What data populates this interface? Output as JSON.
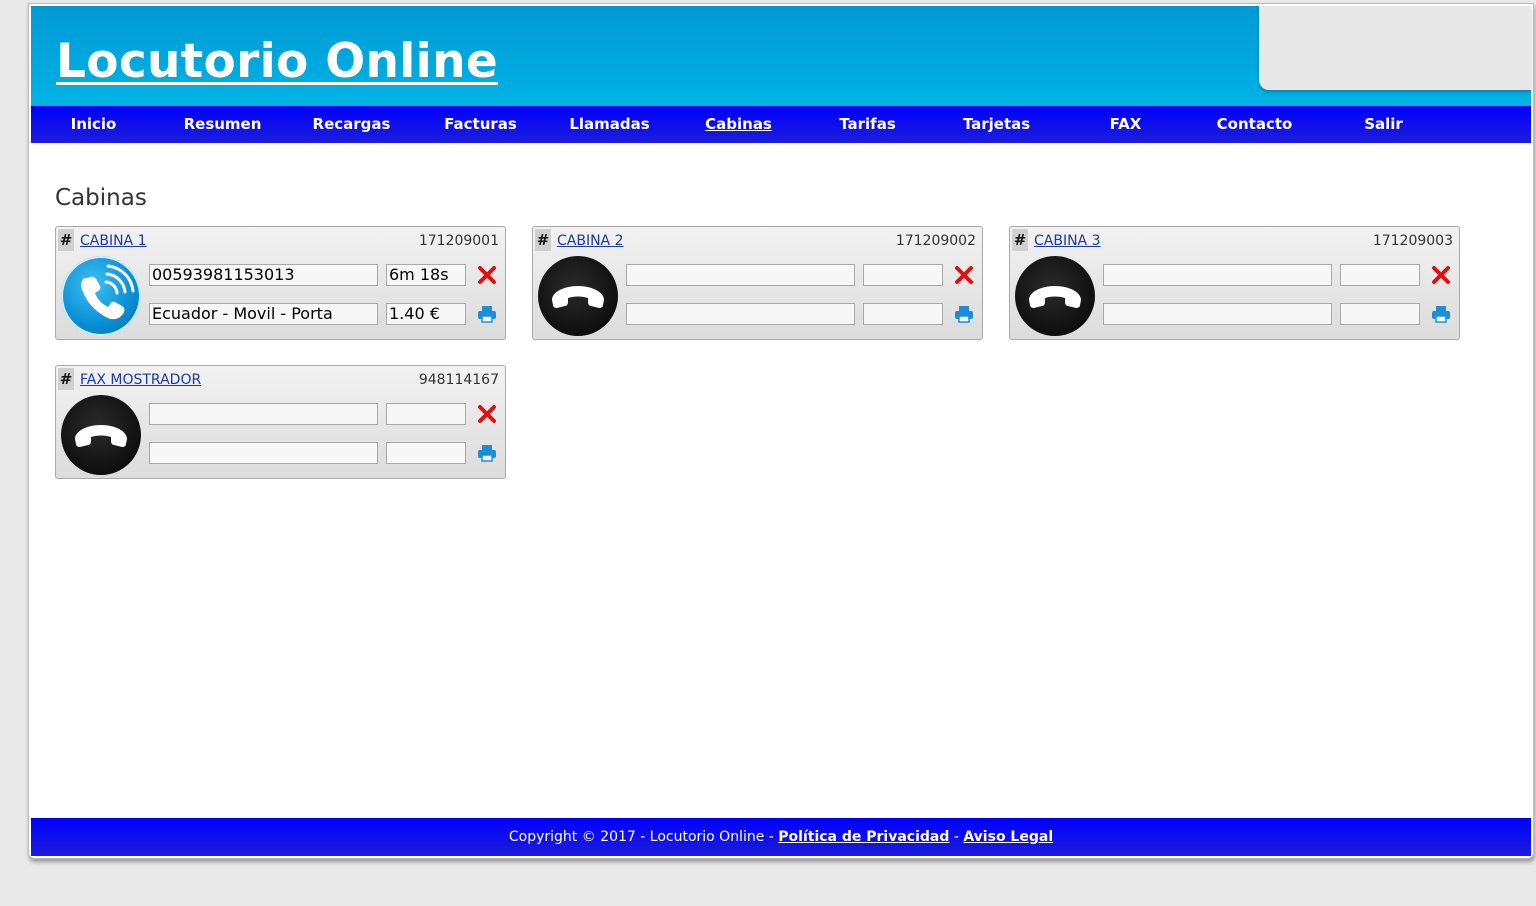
{
  "header": {
    "title": "Locutorio Online"
  },
  "nav": {
    "items": [
      {
        "label": "Inicio"
      },
      {
        "label": "Resumen"
      },
      {
        "label": "Recargas"
      },
      {
        "label": "Facturas"
      },
      {
        "label": "Llamadas"
      },
      {
        "label": "Cabinas"
      },
      {
        "label": "Tarifas"
      },
      {
        "label": "Tarjetas"
      },
      {
        "label": "FAX"
      },
      {
        "label": "Contacto"
      },
      {
        "label": "Salir"
      }
    ],
    "active": "Cabinas"
  },
  "page": {
    "title": "Cabinas"
  },
  "cabinas": [
    {
      "hash": "#",
      "name": "CABINA 1",
      "number": "171209001",
      "status": "active",
      "phone_icon": "phone-ringing-icon",
      "dialed": "00593981153013",
      "duration": "6m 18s",
      "destination": "Ecuador - Movil - Porta",
      "price": "1.40 €"
    },
    {
      "hash": "#",
      "name": "CABINA 2",
      "number": "171209002",
      "status": "idle",
      "phone_icon": "phone-hangup-icon",
      "dialed": "",
      "duration": "",
      "destination": "",
      "price": ""
    },
    {
      "hash": "#",
      "name": "CABINA 3",
      "number": "171209003",
      "status": "idle",
      "phone_icon": "phone-hangup-icon",
      "dialed": "",
      "duration": "",
      "destination": "",
      "price": ""
    },
    {
      "hash": "#",
      "name": "FAX MOSTRADOR",
      "number": "948114167",
      "status": "idle",
      "phone_icon": "phone-hangup-icon",
      "dialed": "",
      "duration": "",
      "destination": "",
      "price": ""
    }
  ],
  "icons": {
    "close": "close-icon",
    "print": "print-icon"
  },
  "colors": {
    "header": "#00a6dd",
    "nav": "#0a0aee",
    "close": "#e01010",
    "print": "#1a8fd8"
  },
  "footer": {
    "text": "Copyright © 2017 - Locutorio Online - ",
    "privacy": "Política de Privacidad",
    "sep": " - ",
    "legal": "Aviso Legal"
  }
}
